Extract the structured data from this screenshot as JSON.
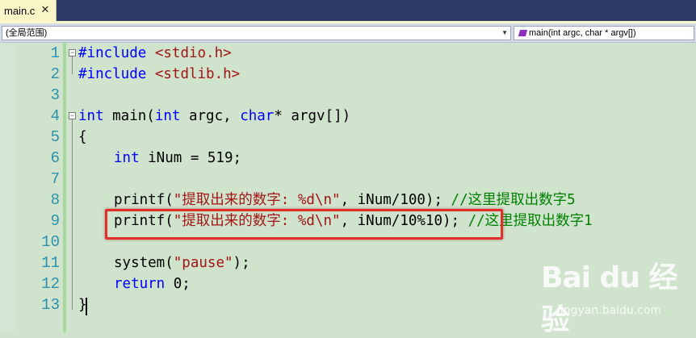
{
  "tab": {
    "title": "main.c",
    "close": "✕"
  },
  "nav": {
    "scope": "(全局范围)",
    "member": "main(int argc, char * argv[])",
    "scope_arrow": "▼",
    "member_arrow": "▼"
  },
  "line_numbers": [
    "1",
    "2",
    "3",
    "4",
    "5",
    "6",
    "7",
    "8",
    "9",
    "10",
    "11",
    "12",
    "13"
  ],
  "code": {
    "l1_pp": "#include",
    "l1_inc": "<stdio.h>",
    "l2_pp": "#include",
    "l2_inc": "<stdlib.h>",
    "l4_kw1": "int",
    "l4_a": " main(",
    "l4_kw2": "int",
    "l4_b": " argc, ",
    "l4_kw3": "char",
    "l4_c": "* argv[])",
    "l5": "{",
    "l6_kw": "int",
    "l6_rest": " iNum = 519;",
    "l8_a": "printf(",
    "l8_str": "\"提取出来的数字: %d\\n\"",
    "l8_b": ", iNum/100); ",
    "l8_cm": "//这里提取出数字5",
    "l9_a": "printf(",
    "l9_str": "\"提取出来的数字: %d\\n\"",
    "l9_b": ", iNum/10%10); ",
    "l9_cm": "//这里提取出数字1",
    "l11_a": "system(",
    "l11_str": "\"pause\"",
    "l11_b": ");",
    "l12_kw": "return",
    "l12_rest": " 0;",
    "l13": "}"
  },
  "watermark": {
    "logo": "Bai du 经验",
    "url": "jingyan.baidu.com"
  },
  "colors": {
    "keyword": "#0000ff",
    "string": "#a31515",
    "comment": "#008000",
    "line_number": "#2b91af",
    "editor_bg": "#cfe3cd",
    "highlight_box": "#e0302c"
  }
}
